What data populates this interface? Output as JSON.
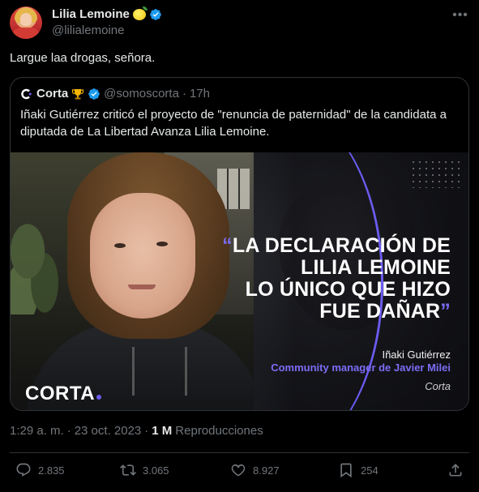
{
  "author": {
    "name": "Lilia Lemoine",
    "handle": "@lilialemoine",
    "avatar_icon": "avatar",
    "verified_color": "#1d9bf0"
  },
  "tweet": {
    "text": "Largue laa drogas, señora."
  },
  "quoted": {
    "name": "Corta",
    "handle": "@somoscorta",
    "time": "17h",
    "text": "Iñaki Gutiérrez criticó el proyecto de \"renuncia de paternidad\" de la candidata a diputada de La Libertad Avanza Lilia Lemoine.",
    "image": {
      "headline_lines": [
        "LA DECLARACIÓN DE",
        "LILIA LEMOINE",
        "LO ÚNICO QUE HIZO",
        "FUE DAÑAR"
      ],
      "open_quote": "“",
      "close_quote": "”",
      "credit_name": "Iñaki Gutiérrez",
      "credit_role": "Community manager de Javier Milei",
      "credit_source": "Corta",
      "brand": "CORTA",
      "accent_color": "#6b5cf0"
    }
  },
  "meta": {
    "time": "1:29 a. m.",
    "separator": "·",
    "date": "23 oct. 2023",
    "views_count": "1 M",
    "views_label": "Reproducciones"
  },
  "actions": {
    "replies": "2.835",
    "reposts": "3.065",
    "likes": "8.927",
    "bookmarks": "254"
  }
}
